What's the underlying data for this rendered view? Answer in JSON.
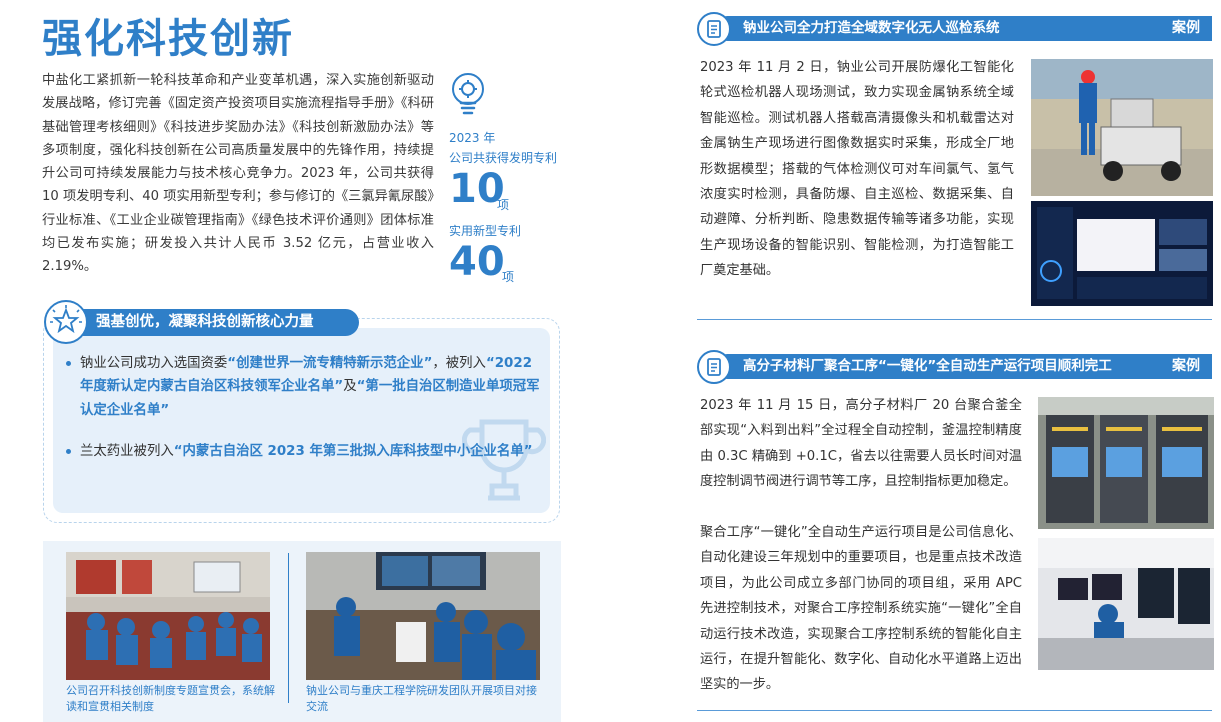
{
  "left": {
    "title": "强化科技创新",
    "intro": "中盐化工紧抓新一轮科技革命和产业变革机遇，深入实施创新驱动发展战略，修订完善《固定资产投资项目实施流程指导手册》《科研基础管理考核细则》《科技进步奖励办法》《科技创新激励办法》等多项制度，强化科技创新在公司高质量发展中的先锋作用，持续提升公司可持续发展能力与技术核心竞争力。2023 年，公司共获得 10 项发明专利、40 项实用新型专利；参与修订的《三氯异氰尿酸》行业标准、《工业企业碳管理指南》《绿色技术评价通则》团体标准均已发布实施；研发投入共计人民币 3.52 亿元，占营业收入 2.19%。",
    "stats": {
      "year": "2023 年",
      "label1": "公司共获得发明专利",
      "num1": "10",
      "unit1": "项",
      "label2": "实用新型专利",
      "num2": "40",
      "unit2": "项"
    },
    "section": {
      "title": "强基创优，凝聚科技创新核心力量",
      "b1_pre": "钠业公司成功入选国资委",
      "b1_hl1": "“创建世界一流专精特新示范企业”",
      "b1_mid1": "，被列入",
      "b1_hl2": "“2022 年度新认定内蒙古自治区科技领军企业名单”",
      "b1_mid2": "及",
      "b1_hl3": "“第一批自治区制造业单项冠军认定企业名单”",
      "b2_pre": "兰太药业被列入",
      "b2_hl": "“内蒙古自治区 2023 年第三批拟入库科技型中小企业名单”"
    },
    "photos": {
      "cap1": "公司召开科技创新制度专题宣贯会，系统解读和宣贯相关制度",
      "cap2": "钠业公司与重庆工程学院研发团队开展项目对接交流"
    }
  },
  "right": {
    "case1": {
      "title": "钠业公司全力打造全域数字化无人巡检系统",
      "tag": "案例",
      "text": "2023 年 11 月 2 日，钠业公司开展防爆化工智能化轮式巡检机器人现场测试，致力实现金属钠系统全域智能巡检。测试机器人搭载高清摄像头和机载雷达对金属钠生产现场进行图像数据实时采集，形成全厂地形数据模型；搭载的气体检测仪可对车间氯气、氢气浓度实时检测，具备防爆、自主巡检、数据采集、自动避障、分析判断、隐患数据传输等诸多功能，实现生产现场设备的智能识别、智能检测，为打造智能工厂奠定基础。"
    },
    "case2": {
      "title": "高分子材料厂聚合工序“一键化”全自动生产运行项目顺利完工",
      "tag": "案例",
      "text1": "2023 年 11 月 15 日，高分子材料厂 20 台聚合釜全部实现“入料到出料”全过程全自动控制，釜温控制精度由 0.3C 精确到 +0.1C，省去以往需要人员长时间对温度控制调节阀进行调节等工序，且控制指标更加稳定。",
      "text2": "聚合工序“一键化”全自动生产运行项目是公司信息化、自动化建设三年规划中的重要项目，也是重点技术改造项目，为此公司成立多部门协同的项目组，采用 APC 先进控制技术，对聚合工序控制系统实施“一键化”全自动运行技术改造，实现聚合工序控制系统的智能化自主运行，在提升智能化、数字化、自动化水平道路上迈出坚实的一步。"
    }
  },
  "colors": {
    "accent": "#2f7fc8",
    "panel": "#e6f0fa"
  }
}
